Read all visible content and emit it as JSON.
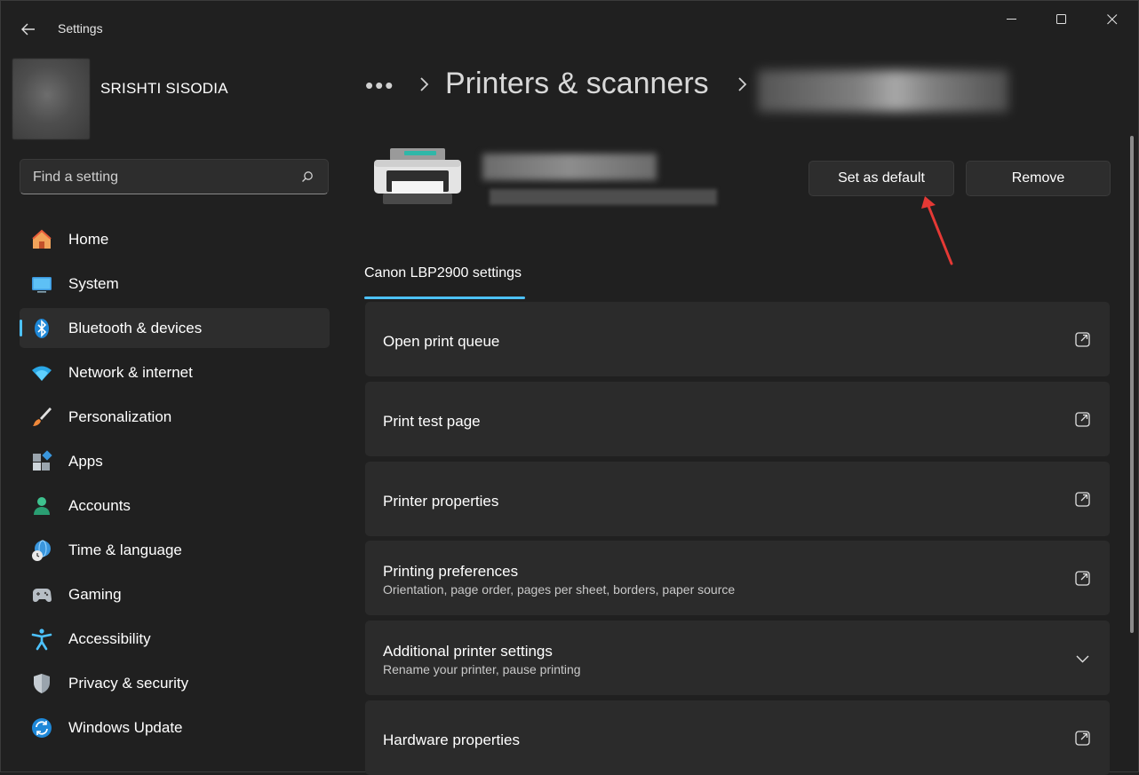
{
  "window": {
    "title": "Settings"
  },
  "profile": {
    "name": "SRISHTI SISODIA"
  },
  "search": {
    "placeholder": "Find a setting"
  },
  "sidebar": {
    "items": [
      {
        "label": "Home",
        "icon": "home-icon"
      },
      {
        "label": "System",
        "icon": "system-icon"
      },
      {
        "label": "Bluetooth & devices",
        "icon": "bluetooth-icon",
        "active": true
      },
      {
        "label": "Network & internet",
        "icon": "wifi-icon"
      },
      {
        "label": "Personalization",
        "icon": "brush-icon"
      },
      {
        "label": "Apps",
        "icon": "apps-icon"
      },
      {
        "label": "Accounts",
        "icon": "accounts-icon"
      },
      {
        "label": "Time & language",
        "icon": "globe-clock-icon"
      },
      {
        "label": "Gaming",
        "icon": "gamepad-icon"
      },
      {
        "label": "Accessibility",
        "icon": "accessibility-icon"
      },
      {
        "label": "Privacy & security",
        "icon": "shield-icon"
      },
      {
        "label": "Windows Update",
        "icon": "update-icon"
      }
    ]
  },
  "header": {
    "breadcrumb_more": "•••",
    "page_title": "Printers & scanners"
  },
  "printer": {
    "set_default_label": "Set as default",
    "remove_label": "Remove"
  },
  "tab": {
    "label": "Canon LBP2900 settings"
  },
  "cards": [
    {
      "title": "Open print queue",
      "subtitle": "",
      "icon": "open-external-icon"
    },
    {
      "title": "Print test page",
      "subtitle": "",
      "icon": "open-external-icon"
    },
    {
      "title": "Printer properties",
      "subtitle": "",
      "icon": "open-external-icon"
    },
    {
      "title": "Printing preferences",
      "subtitle": "Orientation, page order, pages per sheet, borders, paper source",
      "icon": "open-external-icon"
    },
    {
      "title": "Additional printer settings",
      "subtitle": "Rename your printer, pause printing",
      "icon": "chevron-down-icon"
    },
    {
      "title": "Hardware properties",
      "subtitle": "",
      "icon": "open-external-icon"
    }
  ],
  "colors": {
    "accent": "#4cc2ff",
    "background": "#202020",
    "card": "#2b2b2b",
    "annotation": "#e53935"
  }
}
